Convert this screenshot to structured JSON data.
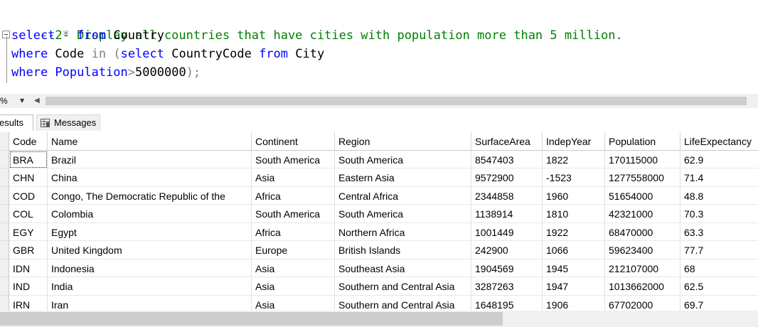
{
  "editor": {
    "line1": {
      "comment": "--2- Display all countries that have cities with population more than 5 million."
    },
    "line2": {
      "kw1": "select",
      "op1": " * ",
      "kw2": "from",
      "id1": " Country"
    },
    "line3": {
      "kw1": "where",
      "id1": " Code ",
      "op1": "in",
      "op2": " (",
      "kw2": "select",
      "id2": " CountryCode ",
      "kw3": "from",
      "id3": " City"
    },
    "line4": {
      "kw1": "where",
      "kw2": " Population",
      "op1": ">",
      "id1": "5000000",
      "op2": ");"
    }
  },
  "zoom": {
    "value": "%"
  },
  "tabs": {
    "results": "esults",
    "messages": "Messages"
  },
  "grid": {
    "columns": [
      "Code",
      "Name",
      "Continent",
      "Region",
      "SurfaceArea",
      "IndepYear",
      "Population",
      "LifeExpectancy"
    ],
    "rows": [
      [
        "BRA",
        "Brazil",
        "South America",
        "South America",
        "8547403",
        "1822",
        "170115000",
        "62.9"
      ],
      [
        "CHN",
        "China",
        "Asia",
        "Eastern Asia",
        "9572900",
        "-1523",
        "1277558000",
        "71.4"
      ],
      [
        "COD",
        "Congo, The Democratic Republic of the",
        "Africa",
        "Central Africa",
        "2344858",
        "1960",
        "51654000",
        "48.8"
      ],
      [
        "COL",
        "Colombia",
        "South America",
        "South America",
        "1138914",
        "1810",
        "42321000",
        "70.3"
      ],
      [
        "EGY",
        "Egypt",
        "Africa",
        "Northern Africa",
        "1001449",
        "1922",
        "68470000",
        "63.3"
      ],
      [
        "GBR",
        "United Kingdom",
        "Europe",
        "British Islands",
        "242900",
        "1066",
        "59623400",
        "77.7"
      ],
      [
        "IDN",
        "Indonesia",
        "Asia",
        "Southeast Asia",
        "1904569",
        "1945",
        "212107000",
        "68"
      ],
      [
        "IND",
        "India",
        "Asia",
        "Southern and Central Asia",
        "3287263",
        "1947",
        "1013662000",
        "62.5"
      ],
      [
        "IRN",
        "Iran",
        "Asia",
        "Southern and Central Asia",
        "1648195",
        "1906",
        "67702000",
        "69.7"
      ]
    ]
  },
  "colors": {
    "keyword": "#0000ff",
    "comment": "#008000",
    "operator": "#808080"
  },
  "icons": {
    "messages_tab": "messages-grid-icon",
    "fold": "collapse-minus-icon"
  }
}
